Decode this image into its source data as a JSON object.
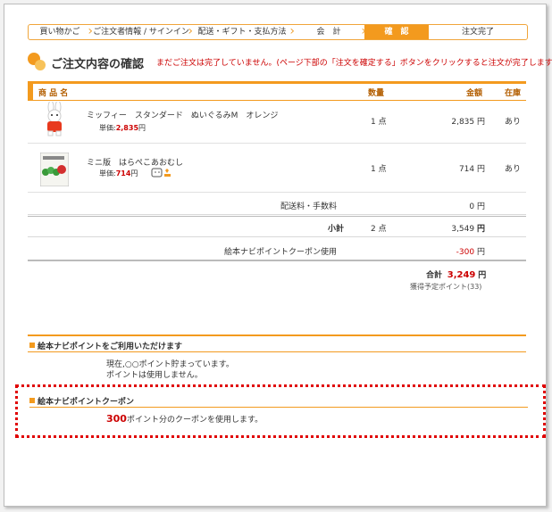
{
  "steps": [
    "買い物かご",
    "ご注文者情報 / サインイン",
    "配送・ギフト・支払方法",
    "会　計",
    "確　認",
    "注文完了"
  ],
  "page_title": "ご注文内容の確認",
  "warning": "まだご注文は完了していません。(ページ下部の「注文を確定する」ボタンをクリックすると注文が完了します)",
  "table_header": {
    "product": "商 品 名",
    "qty": "数量",
    "amount": "金額",
    "stock": "在庫"
  },
  "items": [
    {
      "name": "ミッフィー　スタンダード　ぬいぐるみM　オレンジ",
      "unit_label": "単価:",
      "unit_price": "2,835",
      "unit_suffix": "円",
      "qty": "1 点",
      "amount": "2,835 円",
      "stock": "あり"
    },
    {
      "name": "ミニ版　はらぺこあおむし",
      "unit_label": "単価:",
      "unit_price": "714",
      "unit_suffix": "円",
      "qty": "1 点",
      "amount": "714 円",
      "stock": "あり"
    }
  ],
  "shipping": {
    "label": "配送料・手数料",
    "value": "0 円"
  },
  "subtotal": {
    "label": "小計",
    "qty": "2 点",
    "value": "3,549",
    "unit": "円"
  },
  "coupon_row": {
    "label": "絵本ナビポイントクーポン使用",
    "value": "-300",
    "unit": "円"
  },
  "total": {
    "label": "合計",
    "value": "3,249",
    "unit": "円",
    "points": "獲得予定ポイント(33)"
  },
  "points_section": {
    "title": "絵本ナビポイントをご利用いただけます",
    "line1": "現在,○○ポイント貯まっています。",
    "line2": "ポイントは使用しません。"
  },
  "coupon_section": {
    "title": "絵本ナビポイントクーポン",
    "amount": "300",
    "text": "ポイント分のクーポンを使用します。"
  },
  "colors": {
    "accent": "#f39a1e",
    "warning": "#cc0000",
    "highlight": "#e00000"
  }
}
